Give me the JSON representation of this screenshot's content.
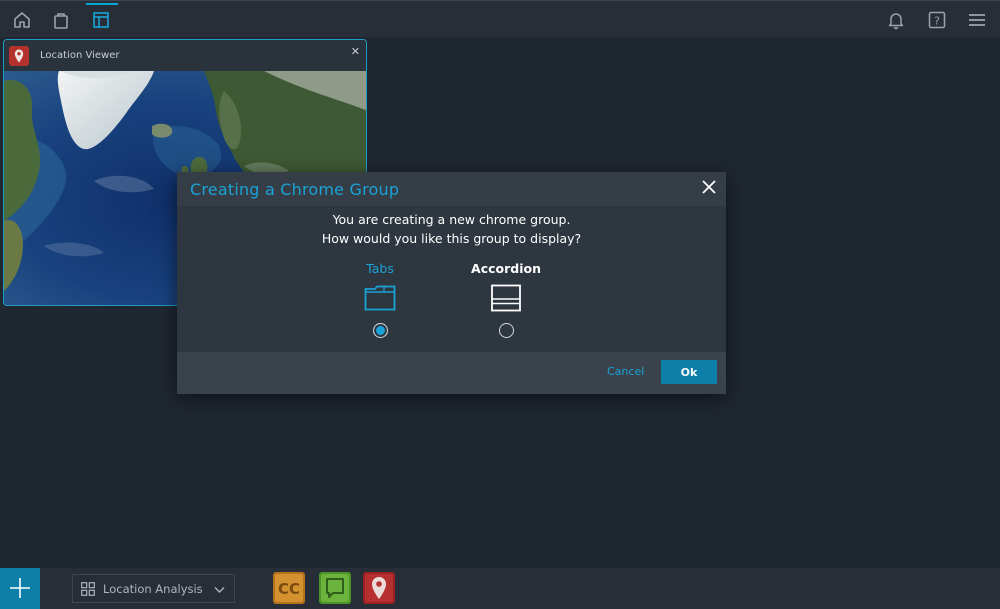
{
  "colors": {
    "background": "#1f2731",
    "bar": "#272e38",
    "accent": "#1aa3d7",
    "primary_button": "#0e7fa8",
    "modal_body": "#2e363f",
    "modal_header": "#353d46",
    "modal_footer": "#3a424c"
  },
  "topbar": {
    "left_icons": [
      "home-icon",
      "bag-icon",
      "layout-icon"
    ],
    "active_icon": "layout-icon",
    "right_icons": [
      "bell-icon",
      "help-icon",
      "menu-icon"
    ],
    "help_glyph": "?"
  },
  "viewer": {
    "title": "Location Viewer",
    "close_glyph": "✕",
    "app_icon": "map-pin-icon",
    "content": "satellite-map"
  },
  "modal": {
    "title": "Creating a Chrome Group",
    "message_line_1": "You are creating a new chrome group.",
    "message_line_2": "How would you like this group to display?",
    "options": [
      {
        "label": "Tabs",
        "icon": "tabs-folder-icon",
        "selected": true
      },
      {
        "label": "Accordion",
        "icon": "accordion-icon",
        "selected": false
      }
    ],
    "cancel_label": "Cancel",
    "ok_label": "Ok",
    "close_icon": "close-icon"
  },
  "bottombar": {
    "add_icon": "plus-icon",
    "workspace_icon": "grid-icon",
    "workspace_label": "Location Analysis",
    "workspace_chevron": "chevron-down-icon",
    "dock_apps": [
      {
        "name": "cc-app",
        "glyph": "CC",
        "color": "#c9861d"
      },
      {
        "name": "chat-app",
        "glyph": "",
        "color": "#5aa532"
      },
      {
        "name": "location-app",
        "glyph": "",
        "color": "#b02a2a"
      }
    ]
  }
}
